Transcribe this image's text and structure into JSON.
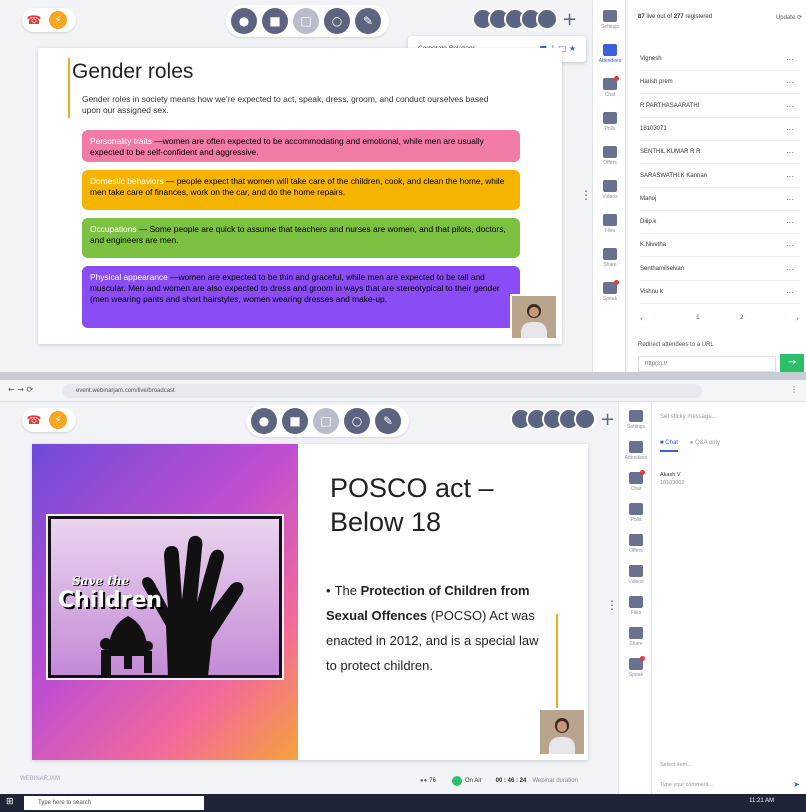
{
  "top": {
    "toolbar_glyphs": {
      "mic": "●",
      "cam": "■",
      "share": "□",
      "chat": "○",
      "pen": "✎"
    },
    "popup": {
      "label": "Corporate Relations",
      "glyphs": "■ ↓ □ ★"
    },
    "slide": {
      "title": "Gender roles",
      "intro": "Gender roles in society means how we’re expected to act, speak, dress, groom, and conduct ourselves based upon our assigned sex.",
      "bands": [
        {
          "head": "Personality traits",
          "text": " —women are often expected to be accommodating and emotional, while men are usually expected to be self-confident and aggressive.",
          "color": "#f17aa7"
        },
        {
          "head": "Domestic behaviors",
          "text": " — people expect that women will take care of the children, cook, and clean the home, while men take care of finances, work on the car, and do the home repairs.",
          "color": "#f5b400"
        },
        {
          "head": "Occupations",
          "text": " — Some people are quick to assume that teachers and nurses are women, and that pilots, doctors, and engineers are men.",
          "color": "#7cc142"
        },
        {
          "head": "Physical appearance",
          "text": " —women are expected to be thin and graceful, while men are expected to be tall and muscular. Men and women are also expected to dress and groom in ways that are stereotypical to their gender (men wearing pants and short hairstyles, women wearing dresses and make-up.",
          "color": "#8a4df5"
        }
      ]
    },
    "rail": [
      {
        "label": "Settings",
        "active": false
      },
      {
        "label": "Attendees",
        "active": true
      },
      {
        "label": "Chat",
        "active": false,
        "dot": true
      },
      {
        "label": "Polls",
        "active": false
      },
      {
        "label": "Offers",
        "active": false
      },
      {
        "label": "Videos",
        "active": false
      },
      {
        "label": "Files",
        "active": false
      },
      {
        "label": "Share",
        "active": false
      },
      {
        "label": "Speak",
        "active": false,
        "dot": true
      }
    ],
    "attendees_header": {
      "live": "87",
      "middle": "live out of",
      "registered": "277",
      "suffix": "registered",
      "update": "Update ⟳"
    },
    "attendees": [
      "Vignesh",
      "Harish prem",
      "R PARTHASAARATHI",
      "18103071",
      "SENTHIL KUMAR R R",
      "SARASWATHI.K Kannan",
      "Manoj",
      "Dilip.k",
      "K.Nivetha",
      "Senthamilselvan",
      "Vishnu k"
    ],
    "pagination": {
      "prev": "‹",
      "p1": "1",
      "p2": "2",
      "next": "›"
    },
    "redirect": {
      "label": "Redirect attendees to a URL",
      "placeholder": "http(s)://",
      "go": "→"
    }
  },
  "bottom": {
    "url": "event.webinarjam.com/live/broadcast",
    "slide": {
      "title_line1": "POSCO act –",
      "title_line2": "Below 18",
      "bullet_pre": "The ",
      "bullet_bold": "Protection of Children from Sexual Offences",
      "bullet_post": " (POCSO) Act was enacted in 2012, and is a special law to protect children.",
      "poster_line1": "Save the",
      "poster_line2": "Children"
    },
    "sticky_placeholder": "Set sticky message...",
    "tabs": {
      "chat": "Chat",
      "qa": "Q&A only"
    },
    "message": {
      "author": "Akash V",
      "text": "18103002"
    },
    "select_item": "Select item...",
    "type_placeholder": "Type your comment...",
    "status": {
      "brand": "WEBINARJAM",
      "count": "76",
      "onair": "On Air",
      "timer": "00 : 46 : 24",
      "timer_label": "Webinar duration"
    },
    "taskbar_search": "Type here to search",
    "clock": "11:21 AM"
  },
  "colors": {
    "accent": "#3a63d8",
    "green": "#2bbf6a",
    "red_call": "#e53935",
    "orange": "#f5a623"
  }
}
